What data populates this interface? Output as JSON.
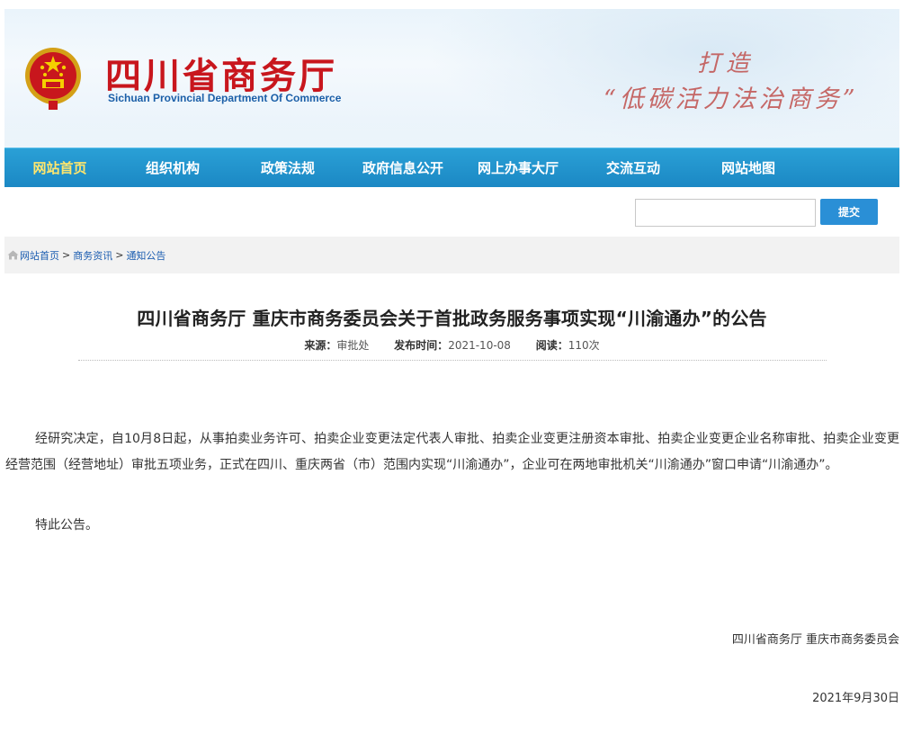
{
  "header": {
    "title": "四川省商务厅",
    "subtitle": "Sichuan Provincial Department Of Commerce",
    "slogan_line1": "打造",
    "slogan_line2": "“低碳活力法治商务”"
  },
  "nav": {
    "items": [
      {
        "label": "网站首页",
        "active": true
      },
      {
        "label": "组织机构"
      },
      {
        "label": "政策法规"
      },
      {
        "label": "政府信息公开"
      },
      {
        "label": "网上办事大厅"
      },
      {
        "label": "交流互动"
      },
      {
        "label": "网站地图"
      }
    ]
  },
  "search": {
    "value": "",
    "button_label": "提交"
  },
  "breadcrumb": {
    "items": [
      "网站首页",
      "商务资讯",
      "通知公告"
    ],
    "separator": ">"
  },
  "article": {
    "title": "四川省商务厅 重庆市商务委员会关于首批政务服务事项实现“川渝通办”的公告",
    "meta": {
      "source_label": "来源：",
      "source_value": "审批处",
      "date_label": "发布时间：",
      "date_value": "2021-10-08",
      "reads_label": "阅读：",
      "reads_value": "110次"
    },
    "paragraph1": "经研究决定，自10月8日起，从事拍卖业务许可、拍卖企业变更法定代表人审批、拍卖企业变更注册资本审批、拍卖企业变更企业名称审批、拍卖企业变更经营范围（经营地址）审批五项业务，正式在四川、重庆两省（市）范围内实现“川渝通办”，企业可在两地审批机关“川渝通办”窗口申请“川渝通办”。",
    "paragraph2": "特此公告。",
    "signature": "四川省商务厅 重庆市商务委员会",
    "sign_date": "2021年9月30日"
  },
  "colors": {
    "title_red": "#c8161d",
    "nav_blue": "#1b88c4",
    "nav_active": "#ffe66d",
    "link_blue": "#1a5cb0",
    "button_blue": "#2a8fd6"
  },
  "icons": {
    "emblem": "national-emblem-icon",
    "breadcrumb_home": "home-icon"
  }
}
